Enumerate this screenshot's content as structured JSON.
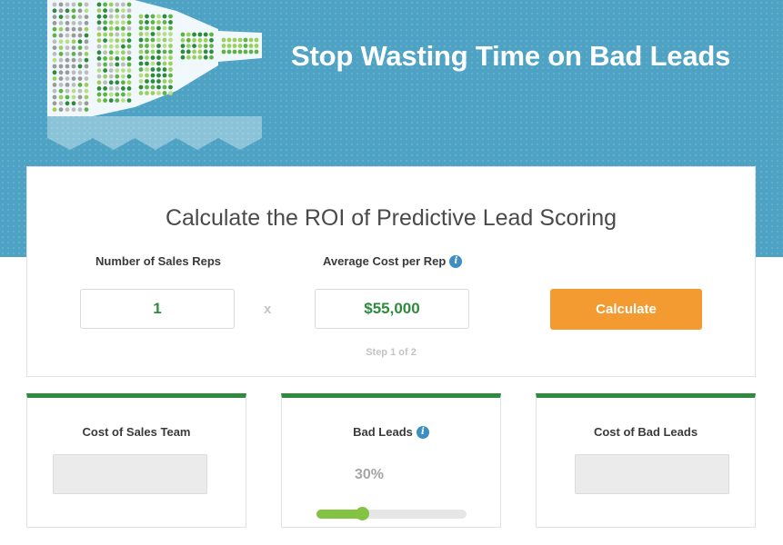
{
  "colors": {
    "hero_background": "#4ea3c4",
    "accent_green": "#2e8b3e",
    "slider_green": "#82c341",
    "button_orange": "#f39a30"
  },
  "hero": {
    "headline": "Stop Wasting Time on Bad Leads",
    "graphic": "lead-funnel-dot-matrix"
  },
  "calculator": {
    "title": "Calculate the ROI of Predictive Lead Scoring",
    "sales_reps": {
      "label": "Number of Sales Reps",
      "value": "1"
    },
    "multiply_symbol": "x",
    "cost_per_rep": {
      "label": "Average Cost per Rep",
      "value": "$55,000",
      "info_icon": "info-icon"
    },
    "calculate_label": "Calculate",
    "step": "Step 1 of 2"
  },
  "results": {
    "cost_of_sales_team": {
      "title": "Cost of Sales Team",
      "value": ""
    },
    "bad_leads": {
      "title": "Bad Leads",
      "percent_label": "30%",
      "percent": 30,
      "info_icon": "info-icon"
    },
    "cost_of_bad_leads": {
      "title": "Cost of Bad Leads",
      "value": ""
    }
  }
}
